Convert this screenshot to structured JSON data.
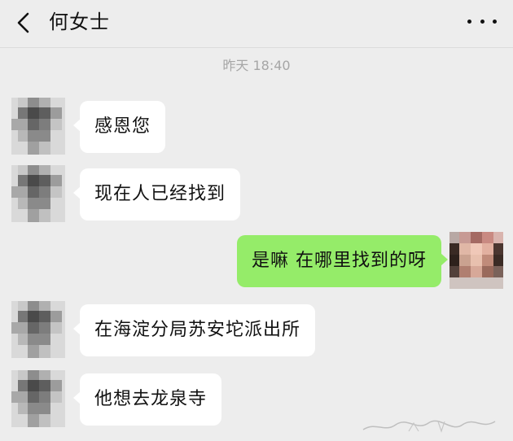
{
  "header": {
    "back_icon": "chevron-left-icon",
    "title": "何女士",
    "more_icon": "ellipsis-icon"
  },
  "timestamp": "昨天 18:40",
  "messages": [
    {
      "side": "in",
      "text": "感恩您"
    },
    {
      "side": "in",
      "text": "现在人已经找到"
    },
    {
      "side": "out",
      "text": "是嘛 在哪里找到的呀"
    },
    {
      "side": "in",
      "text": "在海淀分局苏安坨派出所"
    },
    {
      "side": "in",
      "text": "他想去龙泉寺"
    }
  ],
  "colors": {
    "background": "#ededed",
    "incoming_bubble": "#ffffff",
    "outgoing_bubble": "#95ec69",
    "timestamp": "#a6a6a6"
  }
}
